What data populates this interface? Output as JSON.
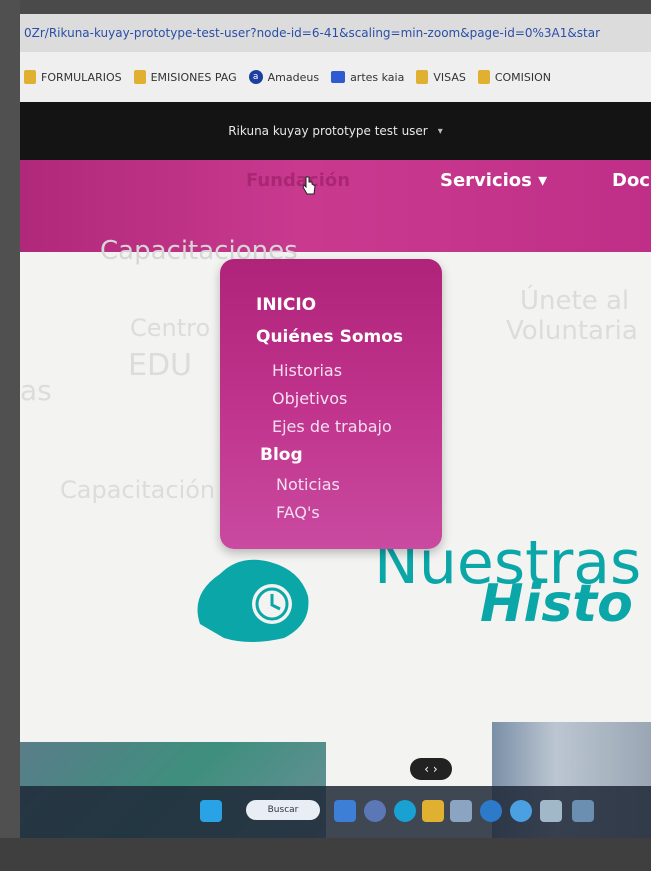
{
  "browser": {
    "url": "0Zr/Rikuna-kuyay-prototype-test-user?node-id=6-41&scaling=min-zoom&page-id=0%3A1&star",
    "bookmarks": [
      "FORMULARIOS",
      "EMISIONES PAG",
      "Amadeus",
      "artes kaia",
      "VISAS",
      "COMISION"
    ]
  },
  "figma": {
    "file_title": "Rikuna kuyay prototype test user",
    "dropdown_caret": "▾"
  },
  "nav": {
    "fundacion": "Fundación",
    "servicios": "Servicios ▾",
    "doc": "Doc"
  },
  "background": {
    "capacitaciones": "Capacitaciones",
    "centro": "Centro",
    "edu": "EDU",
    "as": "as",
    "unete": "Únete al",
    "voluntaria": "Voluntaria",
    "capac": "Capacitación"
  },
  "dropdown": {
    "inicio": "INICIO",
    "quienes": "Quiénes Somos",
    "historias": "Historias",
    "objetivos": "Objetivos",
    "ejes": "Ejes de trabajo",
    "blog": "Blog",
    "noticias": "Noticias",
    "faqs": "FAQ's"
  },
  "hero": {
    "line1": "Nuestras",
    "line2": "Histo"
  },
  "taskbar": {
    "search_label": "Buscar"
  },
  "colors": {
    "magenta": "#b0287a",
    "teal": "#0aa6a8"
  }
}
